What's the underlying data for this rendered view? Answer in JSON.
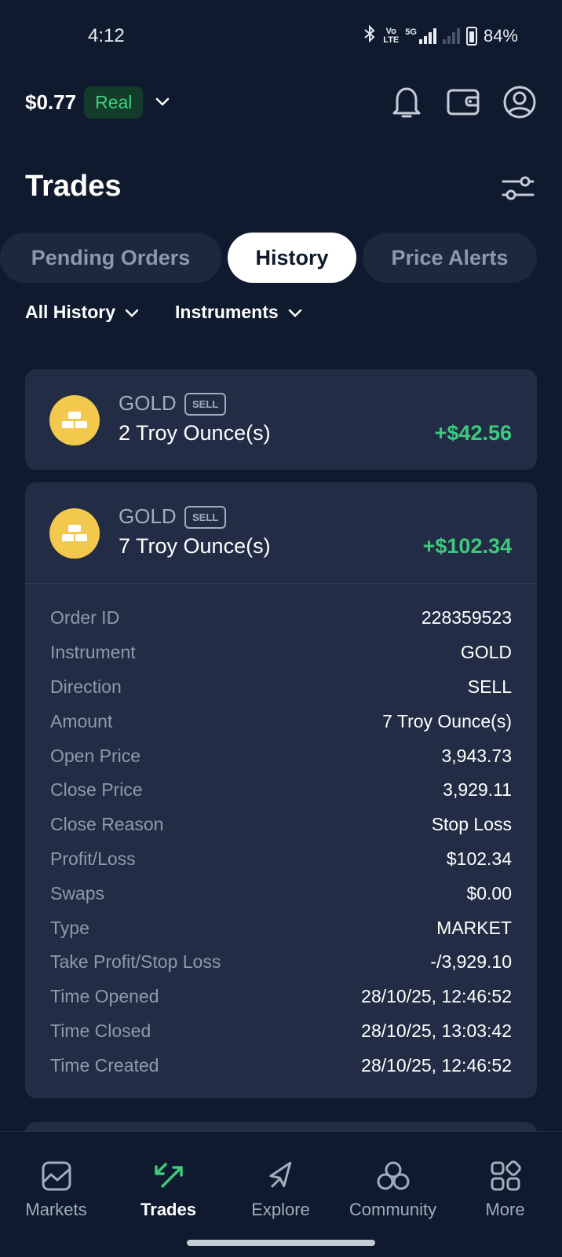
{
  "status_bar": {
    "time": "4:12",
    "net_top": "Vo",
    "net_bottom": "LTE",
    "fiveg": "5G",
    "battery": "84%"
  },
  "header": {
    "balance": "$0.77",
    "account_type": "Real"
  },
  "page": {
    "title": "Trades"
  },
  "tabs": [
    {
      "label": "Pending Orders",
      "active": false
    },
    {
      "label": "History",
      "active": true
    },
    {
      "label": "Price Alerts",
      "active": false
    }
  ],
  "filters": {
    "history": "All History",
    "instruments": "Instruments"
  },
  "trades": [
    {
      "instrument": "GOLD",
      "side": "SELL",
      "quantity": "2 Troy Ounce(s)",
      "pnl": "+$42.56"
    },
    {
      "instrument": "GOLD",
      "side": "SELL",
      "quantity": "7 Troy Ounce(s)",
      "pnl": "+$102.34",
      "details": [
        {
          "label": "Order ID",
          "value": "228359523"
        },
        {
          "label": "Instrument",
          "value": "GOLD"
        },
        {
          "label": "Direction",
          "value": "SELL"
        },
        {
          "label": "Amount",
          "value": "7 Troy Ounce(s)"
        },
        {
          "label": "Open Price",
          "value": "3,943.73"
        },
        {
          "label": "Close Price",
          "value": "3,929.11"
        },
        {
          "label": "Close Reason",
          "value": "Stop Loss"
        },
        {
          "label": "Profit/Loss",
          "value": "$102.34"
        },
        {
          "label": "Swaps",
          "value": "$0.00"
        },
        {
          "label": "Type",
          "value": "MARKET"
        },
        {
          "label": "Take Profit/Stop Loss",
          "value": "-/3,929.10"
        },
        {
          "label": "Time Opened",
          "value": "28/10/25, 12:46:52"
        },
        {
          "label": "Time Closed",
          "value": "28/10/25, 13:03:42"
        },
        {
          "label": "Time Created",
          "value": "28/10/25, 12:46:52"
        }
      ]
    }
  ],
  "nav": [
    {
      "label": "Markets",
      "icon": "chart-icon"
    },
    {
      "label": "Trades",
      "icon": "trades-arrows-icon"
    },
    {
      "label": "Explore",
      "icon": "compass-icon"
    },
    {
      "label": "Community",
      "icon": "community-icon"
    },
    {
      "label": "More",
      "icon": "grid-icon"
    }
  ],
  "colors": {
    "background": "#0f1a2e",
    "card": "#222d45",
    "profit": "#3ec97e",
    "accent_green": "#3ad27d",
    "gold": "#f2c94c"
  }
}
